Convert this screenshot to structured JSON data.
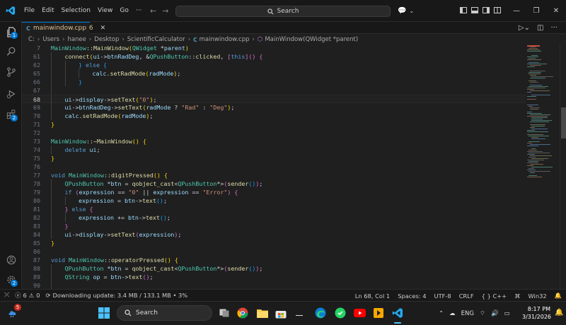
{
  "menu": [
    "File",
    "Edit",
    "Selection",
    "View",
    "Go",
    "···"
  ],
  "search": {
    "label": "Search"
  },
  "tab": {
    "lang": "C",
    "filename": "mainwindow.cpp",
    "problems": "6"
  },
  "activity_badges": {
    "explorer": "1",
    "extensions": "2"
  },
  "breadcrumb": {
    "parts": [
      "C:",
      "Users",
      "hanee",
      "Desktop",
      "ScientificCalculator"
    ],
    "file_lang": "C",
    "file": "mainwindow.cpp",
    "symbol": "MainWindow(QWidget *parent)"
  },
  "code_lines": [
    {
      "n": "7",
      "indent": 0,
      "tokens": [
        [
          "t-type",
          "MainWindow"
        ],
        [
          "t-pn",
          "::"
        ],
        [
          "t-fn",
          "MainWindow"
        ],
        [
          "t-br1",
          "("
        ],
        [
          "t-type",
          "QWidget"
        ],
        [
          "t-pn",
          " *"
        ],
        [
          "t-var",
          "parent"
        ],
        [
          "t-br1",
          ")"
        ]
      ]
    },
    {
      "n": "61",
      "indent": 1,
      "tokens": [
        [
          "t-fn",
          "connect"
        ],
        [
          "t-br1",
          "("
        ],
        [
          "t-var",
          "ui"
        ],
        [
          "t-pn",
          "->"
        ],
        [
          "t-var",
          "btnRadDeg"
        ],
        [
          "t-pn",
          ", &"
        ],
        [
          "t-type",
          "QPushButton"
        ],
        [
          "t-pn",
          "::"
        ],
        [
          "t-fn",
          "clicked"
        ],
        [
          "t-pn",
          ", "
        ],
        [
          "t-br2",
          "["
        ],
        [
          "t-kw",
          "this"
        ],
        [
          "t-br2",
          "]"
        ],
        [
          "t-br2",
          "()"
        ],
        [
          "t-pn",
          " "
        ],
        [
          "t-br2",
          "{"
        ]
      ]
    },
    {
      "n": "62",
      "indent": 2,
      "tokens": [
        [
          "t-br3",
          "}"
        ],
        [
          "t-pn",
          " "
        ],
        [
          "t-kw",
          "else"
        ],
        [
          "t-pn",
          " "
        ],
        [
          "t-br3",
          "{"
        ]
      ]
    },
    {
      "n": "65",
      "indent": 3,
      "tokens": [
        [
          "t-var",
          "calc"
        ],
        [
          "t-pn",
          "."
        ],
        [
          "t-fn",
          "setRadMode"
        ],
        [
          "t-br1",
          "("
        ],
        [
          "t-var",
          "radMode"
        ],
        [
          "t-br1",
          ")"
        ],
        [
          "t-pn",
          ";"
        ]
      ]
    },
    {
      "n": "66",
      "indent": 2,
      "tokens": [
        [
          "t-br3",
          "}"
        ]
      ]
    },
    {
      "n": "67",
      "indent": 1,
      "tokens": []
    },
    {
      "n": "68",
      "indent": 1,
      "current": true,
      "tokens": [
        [
          "t-var",
          "ui"
        ],
        [
          "t-pn",
          "->"
        ],
        [
          "t-var",
          "display"
        ],
        [
          "t-pn",
          "->"
        ],
        [
          "t-fn",
          "setText"
        ],
        [
          "t-br1",
          "("
        ],
        [
          "t-str",
          "\"0\""
        ],
        [
          "t-br1",
          ")"
        ],
        [
          "t-pn",
          ";"
        ]
      ]
    },
    {
      "n": "69",
      "indent": 1,
      "tokens": [
        [
          "t-var",
          "ui"
        ],
        [
          "t-pn",
          "->"
        ],
        [
          "t-var",
          "btnRadDeg"
        ],
        [
          "t-pn",
          "->"
        ],
        [
          "t-fn",
          "setText"
        ],
        [
          "t-br1",
          "("
        ],
        [
          "t-var",
          "radMode"
        ],
        [
          "t-pn",
          " ? "
        ],
        [
          "t-str",
          "\"Rad\""
        ],
        [
          "t-pn",
          " : "
        ],
        [
          "t-str",
          "\"Deg\""
        ],
        [
          "t-br1",
          ")"
        ],
        [
          "t-pn",
          ";"
        ]
      ]
    },
    {
      "n": "70",
      "indent": 1,
      "tokens": [
        [
          "t-var",
          "calc"
        ],
        [
          "t-pn",
          "."
        ],
        [
          "t-fn",
          "setRadMode"
        ],
        [
          "t-br1",
          "("
        ],
        [
          "t-var",
          "radMode"
        ],
        [
          "t-br1",
          ")"
        ],
        [
          "t-pn",
          ";"
        ]
      ]
    },
    {
      "n": "71",
      "indent": 0,
      "tokens": [
        [
          "t-br1",
          "}"
        ]
      ]
    },
    {
      "n": "72",
      "indent": 0,
      "tokens": []
    },
    {
      "n": "73",
      "indent": 0,
      "tokens": [
        [
          "t-type",
          "MainWindow"
        ],
        [
          "t-pn",
          "::"
        ],
        [
          "t-fn",
          "~MainWindow"
        ],
        [
          "t-br1",
          "()"
        ],
        [
          "t-pn",
          " "
        ],
        [
          "t-br1",
          "{"
        ]
      ]
    },
    {
      "n": "74",
      "indent": 1,
      "tokens": [
        [
          "t-kw",
          "delete"
        ],
        [
          "t-pn",
          " "
        ],
        [
          "t-var",
          "ui"
        ],
        [
          "t-pn",
          ";"
        ]
      ]
    },
    {
      "n": "75",
      "indent": 0,
      "tokens": [
        [
          "t-br1",
          "}"
        ]
      ]
    },
    {
      "n": "76",
      "indent": 0,
      "tokens": []
    },
    {
      "n": "77",
      "indent": 0,
      "tokens": [
        [
          "t-kw",
          "void"
        ],
        [
          "t-pn",
          " "
        ],
        [
          "t-type",
          "MainWindow"
        ],
        [
          "t-pn",
          "::"
        ],
        [
          "t-fn",
          "digitPressed"
        ],
        [
          "t-br1",
          "()"
        ],
        [
          "t-pn",
          " "
        ],
        [
          "t-br1",
          "{"
        ]
      ]
    },
    {
      "n": "78",
      "indent": 1,
      "tokens": [
        [
          "t-type",
          "QPushButton"
        ],
        [
          "t-pn",
          " *"
        ],
        [
          "t-var",
          "btn"
        ],
        [
          "t-pn",
          " = "
        ],
        [
          "t-fn",
          "qobject_cast"
        ],
        [
          "t-pn",
          "<"
        ],
        [
          "t-type",
          "QPushButton"
        ],
        [
          "t-pn",
          "*>"
        ],
        [
          "t-br2",
          "("
        ],
        [
          "t-fn",
          "sender"
        ],
        [
          "t-br3",
          "()"
        ],
        [
          "t-br2",
          ")"
        ],
        [
          "t-pn",
          ";"
        ]
      ]
    },
    {
      "n": "79",
      "indent": 1,
      "tokens": [
        [
          "t-kw",
          "if"
        ],
        [
          "t-pn",
          " "
        ],
        [
          "t-br2",
          "("
        ],
        [
          "t-var",
          "expression"
        ],
        [
          "t-pn",
          " == "
        ],
        [
          "t-str",
          "\"0\""
        ],
        [
          "t-pn",
          " || "
        ],
        [
          "t-var",
          "expression"
        ],
        [
          "t-pn",
          " == "
        ],
        [
          "t-str",
          "\"Error\""
        ],
        [
          "t-br2",
          ")"
        ],
        [
          "t-pn",
          " "
        ],
        [
          "t-br2",
          "{"
        ]
      ]
    },
    {
      "n": "80",
      "indent": 2,
      "tokens": [
        [
          "t-var",
          "expression"
        ],
        [
          "t-pn",
          " = "
        ],
        [
          "t-var",
          "btn"
        ],
        [
          "t-pn",
          "->"
        ],
        [
          "t-fn",
          "text"
        ],
        [
          "t-br3",
          "()"
        ],
        [
          "t-pn",
          ";"
        ]
      ]
    },
    {
      "n": "81",
      "indent": 1,
      "tokens": [
        [
          "t-br2",
          "}"
        ],
        [
          "t-pn",
          " "
        ],
        [
          "t-kw",
          "else"
        ],
        [
          "t-pn",
          " "
        ],
        [
          "t-br2",
          "{"
        ]
      ]
    },
    {
      "n": "82",
      "indent": 2,
      "tokens": [
        [
          "t-var",
          "expression"
        ],
        [
          "t-pn",
          " += "
        ],
        [
          "t-var",
          "btn"
        ],
        [
          "t-pn",
          "->"
        ],
        [
          "t-fn",
          "text"
        ],
        [
          "t-br3",
          "()"
        ],
        [
          "t-pn",
          ";"
        ]
      ]
    },
    {
      "n": "83",
      "indent": 1,
      "tokens": [
        [
          "t-br2",
          "}"
        ]
      ]
    },
    {
      "n": "84",
      "indent": 1,
      "tokens": [
        [
          "t-var",
          "ui"
        ],
        [
          "t-pn",
          "->"
        ],
        [
          "t-var",
          "display"
        ],
        [
          "t-pn",
          "->"
        ],
        [
          "t-fn",
          "setText"
        ],
        [
          "t-br2",
          "("
        ],
        [
          "t-var",
          "expression"
        ],
        [
          "t-br2",
          ")"
        ],
        [
          "t-pn",
          ";"
        ]
      ]
    },
    {
      "n": "85",
      "indent": 0,
      "tokens": [
        [
          "t-br1",
          "}"
        ]
      ]
    },
    {
      "n": "86",
      "indent": 0,
      "tokens": []
    },
    {
      "n": "87",
      "indent": 0,
      "tokens": [
        [
          "t-kw",
          "void"
        ],
        [
          "t-pn",
          " "
        ],
        [
          "t-type",
          "MainWindow"
        ],
        [
          "t-pn",
          "::"
        ],
        [
          "t-fn",
          "operatorPressed"
        ],
        [
          "t-br1",
          "()"
        ],
        [
          "t-pn",
          " "
        ],
        [
          "t-br1",
          "{"
        ]
      ]
    },
    {
      "n": "88",
      "indent": 1,
      "tokens": [
        [
          "t-type",
          "QPushButton"
        ],
        [
          "t-pn",
          " *"
        ],
        [
          "t-var",
          "btn"
        ],
        [
          "t-pn",
          " = "
        ],
        [
          "t-fn",
          "qobject_cast"
        ],
        [
          "t-pn",
          "<"
        ],
        [
          "t-type",
          "QPushButton"
        ],
        [
          "t-pn",
          "*>"
        ],
        [
          "t-br2",
          "("
        ],
        [
          "t-fn",
          "sender"
        ],
        [
          "t-br3",
          "()"
        ],
        [
          "t-br2",
          ")"
        ],
        [
          "t-pn",
          ";"
        ]
      ]
    },
    {
      "n": "89",
      "indent": 1,
      "tokens": [
        [
          "t-type",
          "QString"
        ],
        [
          "t-pn",
          " "
        ],
        [
          "t-var",
          "op"
        ],
        [
          "t-pn",
          " = "
        ],
        [
          "t-var",
          "btn"
        ],
        [
          "t-pn",
          "->"
        ],
        [
          "t-fn",
          "text"
        ],
        [
          "t-br2",
          "()"
        ],
        [
          "t-pn",
          ";"
        ]
      ]
    },
    {
      "n": "90",
      "indent": 1,
      "tokens": []
    }
  ],
  "status": {
    "errors": "6",
    "warnings": "0",
    "download": "Downloading update: 3.4 MB / 133.1 MB • 3%",
    "position": "Ln 68, Col 1",
    "spaces": "Spaces: 4",
    "encoding": "UTF-8",
    "eol": "CRLF",
    "language": "C++",
    "platform": "Win32"
  },
  "taskbar": {
    "search_label": "Search",
    "weather_badge": "5",
    "language": "ENG",
    "time": "8:17 PM",
    "date": "3/31/2026"
  },
  "colors": {
    "accent": "#0078d4",
    "editor_bg": "#1f1f1f",
    "chrome_bg": "#181818"
  }
}
